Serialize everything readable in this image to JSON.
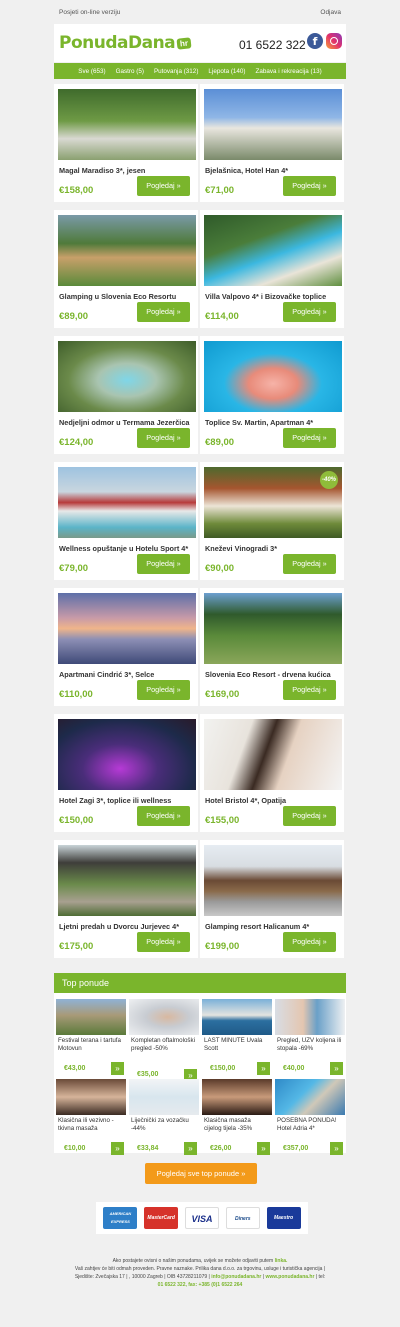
{
  "topbar": {
    "online": "Posjeti on-line verziju",
    "unsubscribe": "Odjava"
  },
  "header": {
    "logo_text": "PonudaDana",
    "logo_badge": "hr",
    "phone": "01 6522 322",
    "facebook_glyph": "f"
  },
  "nav": [
    "Sve (653)",
    "Gastro (5)",
    "Putovanja (312)",
    "Ljepota (140)",
    "Zabava i rekreacija (13)"
  ],
  "offers": [
    {
      "title": "Magal Maradiso 3*, jesen",
      "price": "€158,00",
      "button": "Pogledaj »"
    },
    {
      "title": "Bjelašnica, Hotel Han 4*",
      "price": "€71,00",
      "button": "Pogledaj »"
    },
    {
      "title": "Glamping u Slovenia Eco Resortu",
      "price": "€89,00",
      "button": "Pogledaj »"
    },
    {
      "title": "Villa Valpovo 4* i Bizovačke toplice",
      "price": "€114,00",
      "button": "Pogledaj »"
    },
    {
      "title": "Nedjeljni odmor u Termama Jezerčica",
      "price": "€124,00",
      "button": "Pogledaj »"
    },
    {
      "title": "Toplice Sv. Martin, Apartman 4*",
      "price": "€89,00",
      "button": "Pogledaj »"
    },
    {
      "title": "Wellness opuštanje u Hotelu Sport 4*",
      "price": "€79,00",
      "button": "Pogledaj »"
    },
    {
      "title": "Kneževi Vinogradi 3*",
      "price": "€90,00",
      "button": "Pogledaj »",
      "badge": "-40%"
    },
    {
      "title": "Apartmani Cindrić 3*, Selce",
      "price": "€110,00",
      "button": "Pogledaj »"
    },
    {
      "title": "Slovenia Eco Resort - drvena kućica",
      "price": "€169,00",
      "button": "Pogledaj »"
    },
    {
      "title": "Hotel Zagi 3*, toplice ili wellness",
      "price": "€150,00",
      "button": "Pogledaj »"
    },
    {
      "title": "Hotel Bristol 4*, Opatija",
      "price": "€155,00",
      "button": "Pogledaj »"
    },
    {
      "title": "Ljetni predah u Dvorcu Jurjevec 4*",
      "price": "€175,00",
      "button": "Pogledaj »"
    },
    {
      "title": "Glamping resort Halicanum 4*",
      "price": "€199,00",
      "button": "Pogledaj »"
    }
  ],
  "top_offers": {
    "heading": "Top ponude",
    "arrow": "»",
    "items": [
      {
        "title": "Festival terana i tartufa Motovun",
        "price": "€43,00"
      },
      {
        "title": "Kompletan oftalmološki pregled -50%",
        "price": "€35,00"
      },
      {
        "title": "LAST MINUTE Uvala Scott",
        "price": "€150,00"
      },
      {
        "title": "Pregled, UZV koljena ili stopala -69%",
        "price": "€40,00"
      },
      {
        "title": "Klasična ili vezivno - tkivna masaža",
        "price": "€10,00"
      },
      {
        "title": "Liječnički za vozačku -44%",
        "price": "€33,84"
      },
      {
        "title": "Klasična masaža cijelog tijela -35%",
        "price": "€26,00"
      },
      {
        "title": "POSEBNA PONUDA! Hotel Adria 4*",
        "price": "€357,00"
      }
    ],
    "all_button": "Pogledaj sve top ponude »"
  },
  "payment_cards": [
    "AMERICAN EXPRESS",
    "MasterCard",
    "VISA",
    "Diners",
    "Maestro"
  ],
  "footer": {
    "line1_pre": "Ako postajete ovisni o našim ponudama, uvijek se možete odjaviti putem ",
    "line1_link": "linka.",
    "line2": "Vaš zahtjev će biti odmah proveden. Pravne naznake. Prilika dana d.o.o. za trgovinu, usluge i turistička agencija |",
    "line3_pre": "Sjedište: Zvečajska 17 | , 10000 Zagreb | OIB 43728211079 | ",
    "line3_email": "info@ponudadana.hr",
    "line3_sep": " | ",
    "line3_web": "www.ponudadana.hr",
    "line3_tel": " | tel:",
    "line4": "01 6522 322, fax: +385 (0)1 6522 264"
  }
}
